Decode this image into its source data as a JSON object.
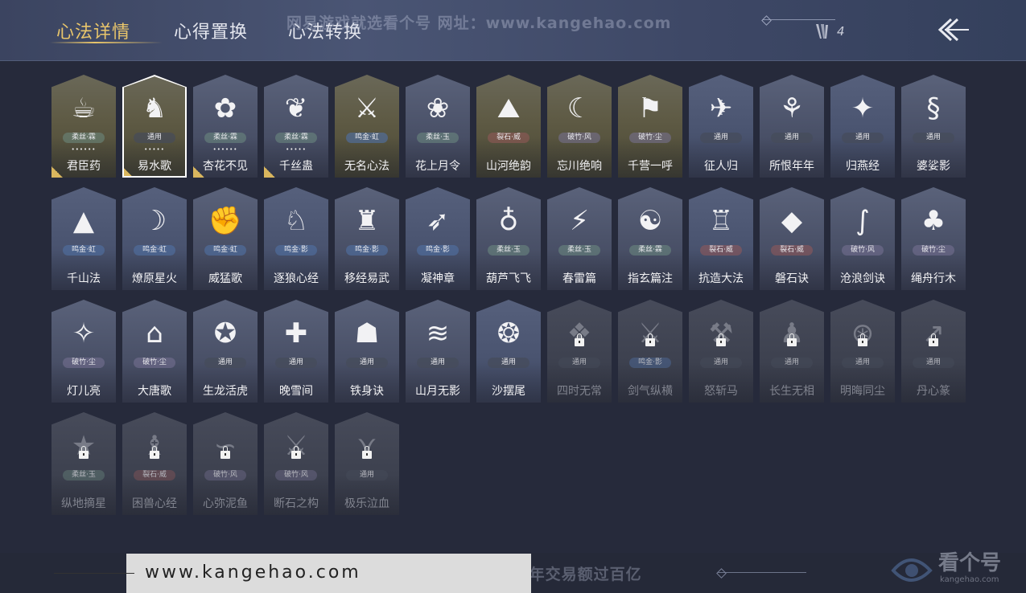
{
  "tabs": [
    {
      "label": "心法详情",
      "active": true
    },
    {
      "label": "心得置换",
      "active": false
    },
    {
      "label": "心法转换",
      "active": false
    }
  ],
  "watermark_top": "网易游戏就选看个号  网址：www.kangehao.com",
  "count": "4",
  "colors": {
    "accent": "#e8c56b",
    "background": "#262a3b",
    "topbar": "#3b4460"
  },
  "cards": [
    {
      "name": "君臣药",
      "tag": "柔丝·霖",
      "icon": "herb-bowl-icon",
      "glyph": "☕",
      "stars": "••••••",
      "variant": "gold",
      "corner": true,
      "locked": false
    },
    {
      "name": "易水歌",
      "tag": "通用",
      "icon": "horse-icon",
      "glyph": "♞",
      "stars": "•••••",
      "variant": "gold",
      "corner": true,
      "locked": false,
      "selected": true
    },
    {
      "name": "杏花不见",
      "tag": "柔丝·霖",
      "icon": "apricot-flower-icon",
      "glyph": "✿",
      "stars": "••••••",
      "variant": "",
      "corner": true,
      "locked": false
    },
    {
      "name": "千丝蛊",
      "tag": "柔丝·霖",
      "icon": "leaf-icon",
      "glyph": "❦",
      "stars": "•••••",
      "variant": "",
      "corner": true,
      "locked": false
    },
    {
      "name": "无名心法",
      "tag": "鸣金·虹",
      "icon": "sword-icon",
      "glyph": "⚔",
      "variant": "gold",
      "locked": false
    },
    {
      "name": "花上月令",
      "tag": "柔丝·玉",
      "icon": "moon-flower-icon",
      "glyph": "❀",
      "variant": "",
      "locked": false
    },
    {
      "name": "山河绝韵",
      "tag": "裂石·威",
      "icon": "mountain-icon",
      "glyph": "⛰",
      "variant": "gold",
      "locked": false
    },
    {
      "name": "忘川绝响",
      "tag": "破竹·风",
      "icon": "mask-icon",
      "glyph": "☾",
      "variant": "gold",
      "locked": false
    },
    {
      "name": "千营一呼",
      "tag": "破竹·尘",
      "icon": "banner-icon",
      "glyph": "⚑",
      "variant": "gold",
      "locked": false
    },
    {
      "name": "征人归",
      "tag": "通用",
      "icon": "bird-icon",
      "glyph": "✈",
      "variant": "blue",
      "locked": false
    },
    {
      "name": "所恨年年",
      "tag": "通用",
      "icon": "bamboo-icon",
      "glyph": "⚘",
      "variant": "",
      "locked": false
    },
    {
      "name": "归燕经",
      "tag": "通用",
      "icon": "swallow-icon",
      "glyph": "✦",
      "variant": "blue",
      "locked": false
    },
    {
      "name": "婆娑影",
      "tag": "通用",
      "icon": "dragon-icon",
      "glyph": "§",
      "variant": "",
      "locked": false
    },
    {
      "name": "千山法",
      "tag": "鸣金·虹",
      "icon": "mountain-range-icon",
      "glyph": "▲",
      "variant": "blue",
      "locked": false
    },
    {
      "name": "燎原星火",
      "tag": "鸣金·虹",
      "icon": "scythe-icon",
      "glyph": "☽",
      "variant": "blue",
      "locked": false
    },
    {
      "name": "威猛歌",
      "tag": "鸣金·虹",
      "icon": "fist-icon",
      "glyph": "✊",
      "variant": "",
      "locked": false
    },
    {
      "name": "逐狼心经",
      "tag": "鸣金·影",
      "icon": "wolf-icon",
      "glyph": "♘",
      "variant": "blue",
      "locked": false
    },
    {
      "name": "移经易武",
      "tag": "鸣金·影",
      "icon": "armor-icon",
      "glyph": "♜",
      "variant": "",
      "locked": false
    },
    {
      "name": "凝神章",
      "tag": "鸣金·影",
      "icon": "bow-icon",
      "glyph": "➶",
      "variant": "blue",
      "locked": false
    },
    {
      "name": "葫芦飞飞",
      "tag": "柔丝·玉",
      "icon": "gourd-icon",
      "glyph": "♁",
      "variant": "",
      "locked": false
    },
    {
      "name": "春雷篇",
      "tag": "柔丝·玉",
      "icon": "thunder-tree-icon",
      "glyph": "⚡",
      "variant": "",
      "locked": false
    },
    {
      "name": "指玄篇注",
      "tag": "柔丝·霖",
      "icon": "taiji-icon",
      "glyph": "☯",
      "variant": "",
      "locked": false
    },
    {
      "name": "抗造大法",
      "tag": "裂石·威",
      "icon": "bell-icon",
      "glyph": "♖",
      "variant": "blue",
      "locked": false
    },
    {
      "name": "磐石诀",
      "tag": "裂石·威",
      "icon": "rock-icon",
      "glyph": "◆",
      "variant": "",
      "locked": false
    },
    {
      "name": "沧浪剑诀",
      "tag": "破竹·风",
      "icon": "serpent-icon",
      "glyph": "∫",
      "variant": "",
      "locked": false
    },
    {
      "name": "绳舟行木",
      "tag": "破竹·尘",
      "icon": "tree-root-icon",
      "glyph": "♣",
      "variant": "",
      "locked": false
    },
    {
      "name": "灯儿亮",
      "tag": "破竹·尘",
      "icon": "lamp-icon",
      "glyph": "✧",
      "variant": "",
      "locked": false
    },
    {
      "name": "大唐歌",
      "tag": "破竹·尘",
      "icon": "palace-icon",
      "glyph": "⌂",
      "variant": "",
      "locked": false
    },
    {
      "name": "生龙活虎",
      "tag": "通用",
      "icon": "dragon-tiger-icon",
      "glyph": "✪",
      "variant": "",
      "locked": false
    },
    {
      "name": "晚雪间",
      "tag": "通用",
      "icon": "cross-sword-icon",
      "glyph": "✚",
      "variant": "",
      "locked": false
    },
    {
      "name": "铁身诀",
      "tag": "通用",
      "icon": "strongman-icon",
      "glyph": "☗",
      "variant": "",
      "locked": false
    },
    {
      "name": "山月无影",
      "tag": "通用",
      "icon": "claw-slash-icon",
      "glyph": "≋",
      "variant": "",
      "locked": false
    },
    {
      "name": "沙摆尾",
      "tag": "通用",
      "icon": "phoenix-icon",
      "glyph": "❂",
      "variant": "blue",
      "locked": false
    },
    {
      "name": "四时无常",
      "tag": "通用",
      "icon": "seasons-icon",
      "glyph": "❖",
      "variant": "locked",
      "locked": true
    },
    {
      "name": "剑气纵横",
      "tag": "鸣金·影",
      "icon": "sword-qi-icon",
      "glyph": "⚔",
      "variant": "locked",
      "locked": true
    },
    {
      "name": "怒斩马",
      "tag": "通用",
      "icon": "blade-icon",
      "glyph": "⚒",
      "variant": "locked",
      "locked": true
    },
    {
      "name": "长生无相",
      "tag": "通用",
      "icon": "immortal-icon",
      "glyph": "♟",
      "variant": "locked",
      "locked": true
    },
    {
      "name": "明晦同尘",
      "tag": "通用",
      "icon": "coiled-dragon-icon",
      "glyph": "⊛",
      "variant": "locked",
      "locked": true
    },
    {
      "name": "丹心篆",
      "tag": "通用",
      "icon": "spear-icon",
      "glyph": "↗",
      "variant": "locked",
      "locked": true
    },
    {
      "name": "纵地摘星",
      "tag": "柔丝·玉",
      "icon": "star-girl-icon",
      "glyph": "★",
      "variant": "locked",
      "locked": true
    },
    {
      "name": "困兽心经",
      "tag": "裂石·威",
      "icon": "beast-icon",
      "glyph": "♝",
      "variant": "locked",
      "locked": true
    },
    {
      "name": "心弥泥鱼",
      "tag": "破竹·风",
      "icon": "fish-icon",
      "glyph": "∽",
      "variant": "locked",
      "locked": true
    },
    {
      "name": "断石之构",
      "tag": "破竹·风",
      "icon": "warrior-icon",
      "glyph": "⚔",
      "variant": "locked",
      "locked": true
    },
    {
      "name": "极乐泣血",
      "tag": "通用",
      "icon": "wings-icon",
      "glyph": "⋎",
      "variant": "locked",
      "locked": true
    }
  ],
  "bottom": {
    "url": "www.kangehao.com",
    "watermark": "看个号专业网易游戏八年  年交易额过百亿",
    "logo_text": "看个号",
    "logo_sub": "kangehao.com"
  }
}
